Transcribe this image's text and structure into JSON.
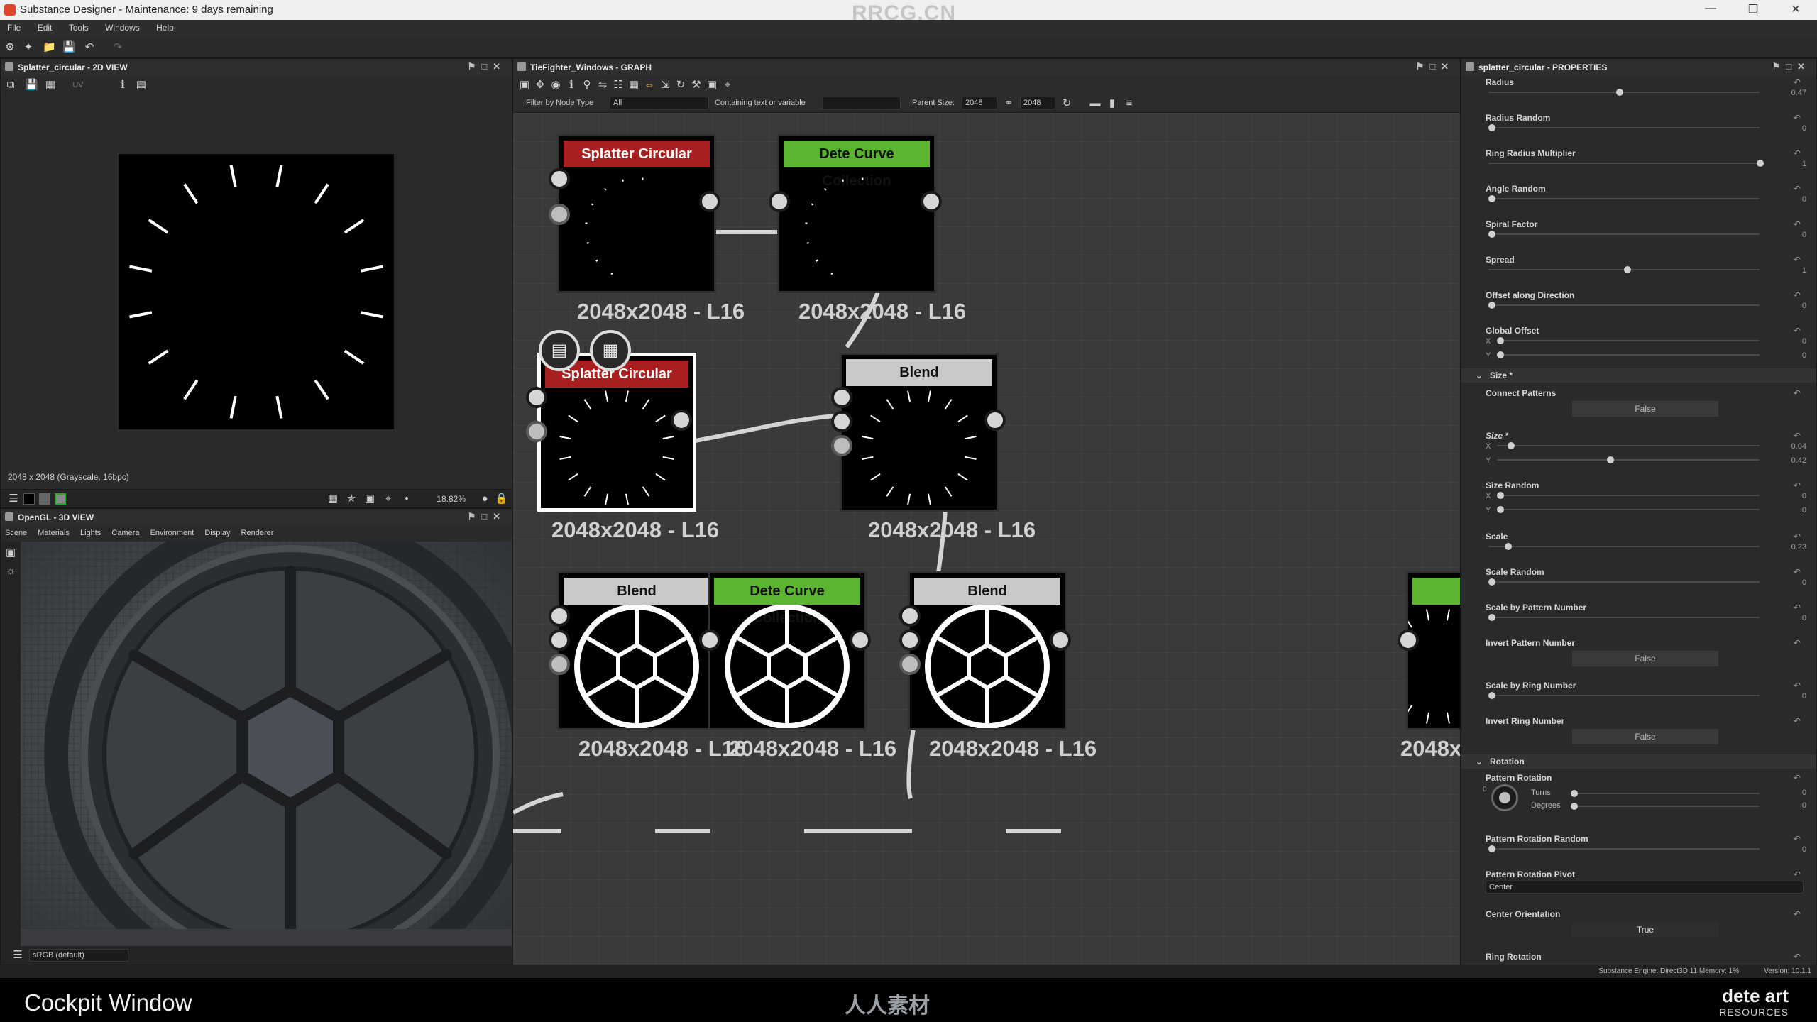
{
  "window": {
    "title": "Substance Designer - Maintenance: 9 days remaining",
    "watermark": "RRCG.CN"
  },
  "menu": [
    "File",
    "Edit",
    "Tools",
    "Windows",
    "Help"
  ],
  "view2d": {
    "title": "Splatter_circular - 2D VIEW",
    "info": "2048 x 2048 (Grayscale, 16bpc)",
    "zoom": "18.82%",
    "uv": "UV"
  },
  "view3d": {
    "title": "OpenGL - 3D VIEW",
    "menu": [
      "Scene",
      "Materials",
      "Lights",
      "Camera",
      "Environment",
      "Display",
      "Renderer"
    ],
    "colorspace": "sRGB (default)"
  },
  "graph": {
    "title": "TieFighter_Windows - GRAPH",
    "filter_label": "Filter by Node Type",
    "filter_value": "All",
    "containing_label": "Containing text or variable",
    "parent_size_label": "Parent Size:",
    "parent_size_w": "2048",
    "parent_size_h": "2048",
    "nodes": [
      {
        "title": "Splatter Circular",
        "label": "2048x2048 - L16"
      },
      {
        "title": "Dete Curve Collection",
        "label": "2048x2048 - L16"
      },
      {
        "title": "Splatter Circular",
        "label": "2048x2048 - L16"
      },
      {
        "title": "Blend",
        "label": "2048x2048 - L16"
      },
      {
        "title": "Blend",
        "label": "2048x2048 - L16"
      },
      {
        "title": "Dete Curve Collection",
        "label": "2048x2048 - L16"
      },
      {
        "title": "Blend",
        "label": "2048x2048 - L16"
      },
      {
        "title": "",
        "label": "2048x"
      }
    ]
  },
  "props": {
    "title": "splatter_circular - PROPERTIES",
    "radius": {
      "label": "Radius",
      "value": "0.47"
    },
    "radius_random": {
      "label": "Radius Random",
      "value": "0"
    },
    "ring_radius_multiplier": {
      "label": "Ring Radius Multiplier",
      "value": "1"
    },
    "angle_random": {
      "label": "Angle Random",
      "value": "0"
    },
    "spiral_factor": {
      "label": "Spiral Factor",
      "value": "0"
    },
    "spread": {
      "label": "Spread",
      "value": "1"
    },
    "offset_along_direction": {
      "label": "Offset along Direction",
      "value": "0"
    },
    "global_offset": {
      "label": "Global Offset",
      "x": "0",
      "y": "0"
    },
    "size_section": "Size *",
    "connect_patterns": {
      "label": "Connect Patterns",
      "value": "False"
    },
    "size": {
      "label": "Size *",
      "x": "0.04",
      "y": "0.42"
    },
    "size_random": {
      "label": "Size Random",
      "x": "0",
      "y": "0"
    },
    "scale": {
      "label": "Scale",
      "value": "0.23"
    },
    "scale_random": {
      "label": "Scale Random",
      "value": "0"
    },
    "scale_by_pattern_number": {
      "label": "Scale by Pattern Number",
      "value": "0"
    },
    "invert_pattern_number": {
      "label": "Invert Pattern Number",
      "value": "False"
    },
    "scale_by_ring_number": {
      "label": "Scale by Ring Number",
      "value": "0"
    },
    "invert_ring_number": {
      "label": "Invert Ring Number",
      "value": "False"
    },
    "rotation_section": "Rotation",
    "pattern_rotation": {
      "label": "Pattern Rotation",
      "turns_label": "Turns",
      "degrees_label": "Degrees",
      "turns": "0",
      "degrees": "0",
      "dial_zero": "0"
    },
    "pattern_rotation_random": {
      "label": "Pattern Rotation Random",
      "value": "0"
    },
    "pattern_rotation_pivot": {
      "label": "Pattern Rotation Pivot",
      "value": "Center"
    },
    "center_orientation": {
      "label": "Center Orientation",
      "value": "True"
    },
    "ring_rotation": {
      "label": "Ring Rotation"
    },
    "axis_x": "X",
    "axis_y": "Y"
  },
  "status": {
    "text": "Substance Engine: Direct3D 11  Memory: 1%",
    "version": "Version: 10.1.1"
  },
  "caption": {
    "title": "Cockpit Window",
    "logo": "人人素材",
    "brand": "dete art",
    "brand_sub": "RESOURCES"
  },
  "colors": {
    "red_header": "#a91e1e",
    "green_header": "#5cb531",
    "gray_header": "#c9c9c9"
  }
}
